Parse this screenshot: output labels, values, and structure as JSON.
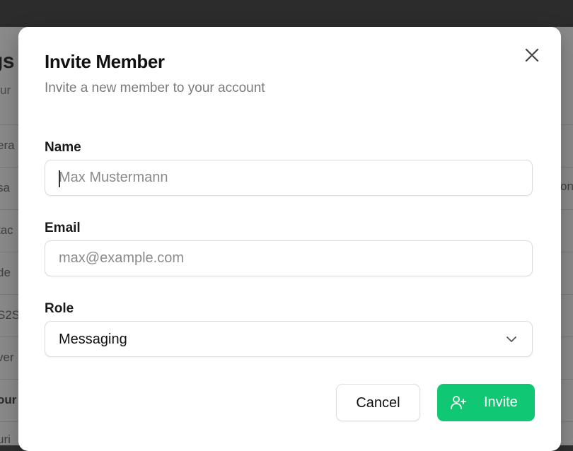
{
  "background": {
    "title_fragment": "gs",
    "subtitle_fragment": "ur",
    "rows": [
      "era",
      "sa",
      "tac",
      "de",
      "S2S",
      "ver",
      "our",
      "uri"
    ],
    "right_fragment": "on"
  },
  "modal": {
    "title": "Invite Member",
    "subtitle": "Invite a new member to your account",
    "close_icon": "close-icon",
    "name": {
      "label": "Name",
      "placeholder": "Max Mustermann",
      "value": ""
    },
    "email": {
      "label": "Email",
      "placeholder": "max@example.com",
      "value": ""
    },
    "role": {
      "label": "Role",
      "selected": "Messaging",
      "icon": "chevron-down-icon"
    },
    "actions": {
      "cancel_label": "Cancel",
      "invite_label": "Invite",
      "invite_icon": "user-plus-icon"
    }
  },
  "colors": {
    "accent": "#10c873",
    "overlay": "#2e2e2e",
    "subtitle_text": "#7a7a7a",
    "border": "#dddddd"
  }
}
